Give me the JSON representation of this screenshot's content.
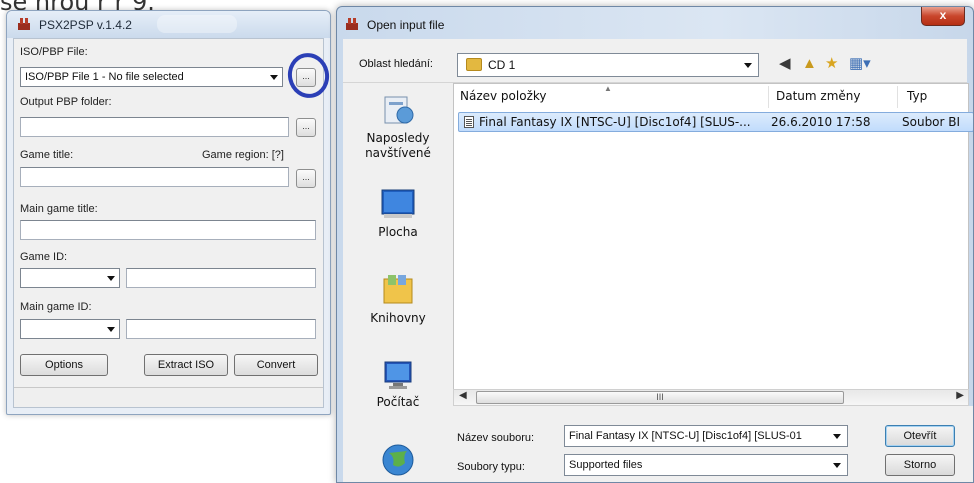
{
  "top_text": "se nrou r r 9.",
  "psx_window": {
    "title": "PSX2PSP v.1.4.2",
    "iso_label": "ISO/PBP File:",
    "iso_value": "ISO/PBP File 1 - No file selected",
    "browse_label": "...",
    "output_label": "Output PBP folder:",
    "game_title_label": "Game title:",
    "game_region_label": "Game region: [?]",
    "main_game_title_label": "Main game title:",
    "game_id_label": "Game ID:",
    "main_game_id_label": "Main game ID:",
    "buttons": {
      "options": "Options",
      "extract": "Extract ISO",
      "convert": "Convert"
    }
  },
  "dialog": {
    "title": "Open input file",
    "close_label": "x",
    "look_in_label": "Oblast hledání:",
    "look_in_value": "CD 1",
    "places": [
      "Naposledy navštívené",
      "Plocha",
      "Knihovny",
      "Počítač"
    ],
    "columns": [
      "Název položky",
      "Datum změny",
      "Typ"
    ],
    "files": [
      {
        "name": "Final Fantasy IX [NTSC-U] [Disc1of4] [SLUS-...",
        "date": "26.6.2010 17:58",
        "type": "Soubor BI"
      }
    ],
    "scroll_thumb": "III",
    "filename_label": "Název souboru:",
    "filename_value": "Final Fantasy IX [NTSC-U] [Disc1of4] [SLUS-01",
    "filetype_label": "Soubory typu:",
    "filetype_value": "Supported files",
    "open_button": "Otevřít",
    "cancel_button": "Storno"
  }
}
